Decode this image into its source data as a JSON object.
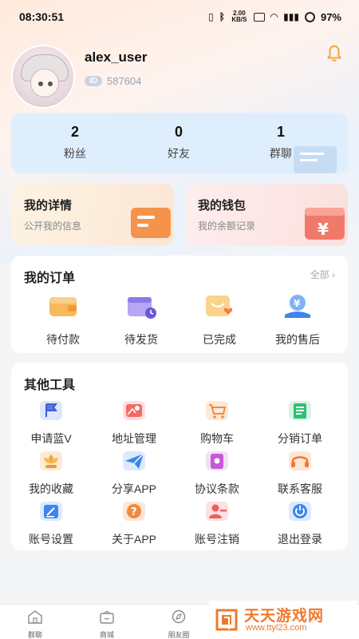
{
  "status_bar": {
    "time": "08:30:51",
    "net_speed": "2.00 KB/S",
    "battery": "97%"
  },
  "profile": {
    "username": "alex_user",
    "uid_badge": "ID",
    "uid": "587604"
  },
  "stats": [
    {
      "value": "2",
      "label": "粉丝"
    },
    {
      "value": "0",
      "label": "好友"
    },
    {
      "value": "1",
      "label": "群聊"
    }
  ],
  "cards": {
    "details": {
      "title": "我的详情",
      "subtitle": "公开我的信息"
    },
    "wallet": {
      "title": "我的钱包",
      "subtitle": "我的余额记录"
    }
  },
  "orders": {
    "title": "我的订单",
    "more": "全部",
    "items": [
      {
        "label": "待付款",
        "icon": "wallet-icon"
      },
      {
        "label": "待发货",
        "icon": "calendar-clock-icon"
      },
      {
        "label": "已完成",
        "icon": "heart-card-icon"
      },
      {
        "label": "我的售后",
        "icon": "yen-hand-icon"
      }
    ]
  },
  "tools": {
    "title": "其他工具",
    "items": [
      {
        "label": "申请蓝V",
        "icon": "flag-icon"
      },
      {
        "label": "地址管理",
        "icon": "map-pin-icon"
      },
      {
        "label": "购物车",
        "icon": "cart-icon"
      },
      {
        "label": "分销订单",
        "icon": "list-doc-icon"
      },
      {
        "label": "我的收藏",
        "icon": "flower-icon"
      },
      {
        "label": "分享APP",
        "icon": "paper-plane-icon"
      },
      {
        "label": "协议条款",
        "icon": "book-icon"
      },
      {
        "label": "联系客服",
        "icon": "headset-icon"
      },
      {
        "label": "账号设置",
        "icon": "edit-icon"
      },
      {
        "label": "关于APP",
        "icon": "question-icon"
      },
      {
        "label": "账号注销",
        "icon": "user-remove-icon"
      },
      {
        "label": "退出登录",
        "icon": "power-icon"
      }
    ]
  },
  "tabbar": [
    {
      "label": "群聊",
      "icon": "home-icon"
    },
    {
      "label": "商城",
      "icon": "shop-bag-icon"
    },
    {
      "label": "朋友圈",
      "icon": "compass-icon"
    }
  ],
  "watermark": {
    "title": "天天游戏网",
    "url": "www.ttyl23.com"
  },
  "colors": {
    "accent_orange": "#f0782c",
    "stats_bg": "#dfeefc",
    "blue_icon": "#3e7de0"
  }
}
